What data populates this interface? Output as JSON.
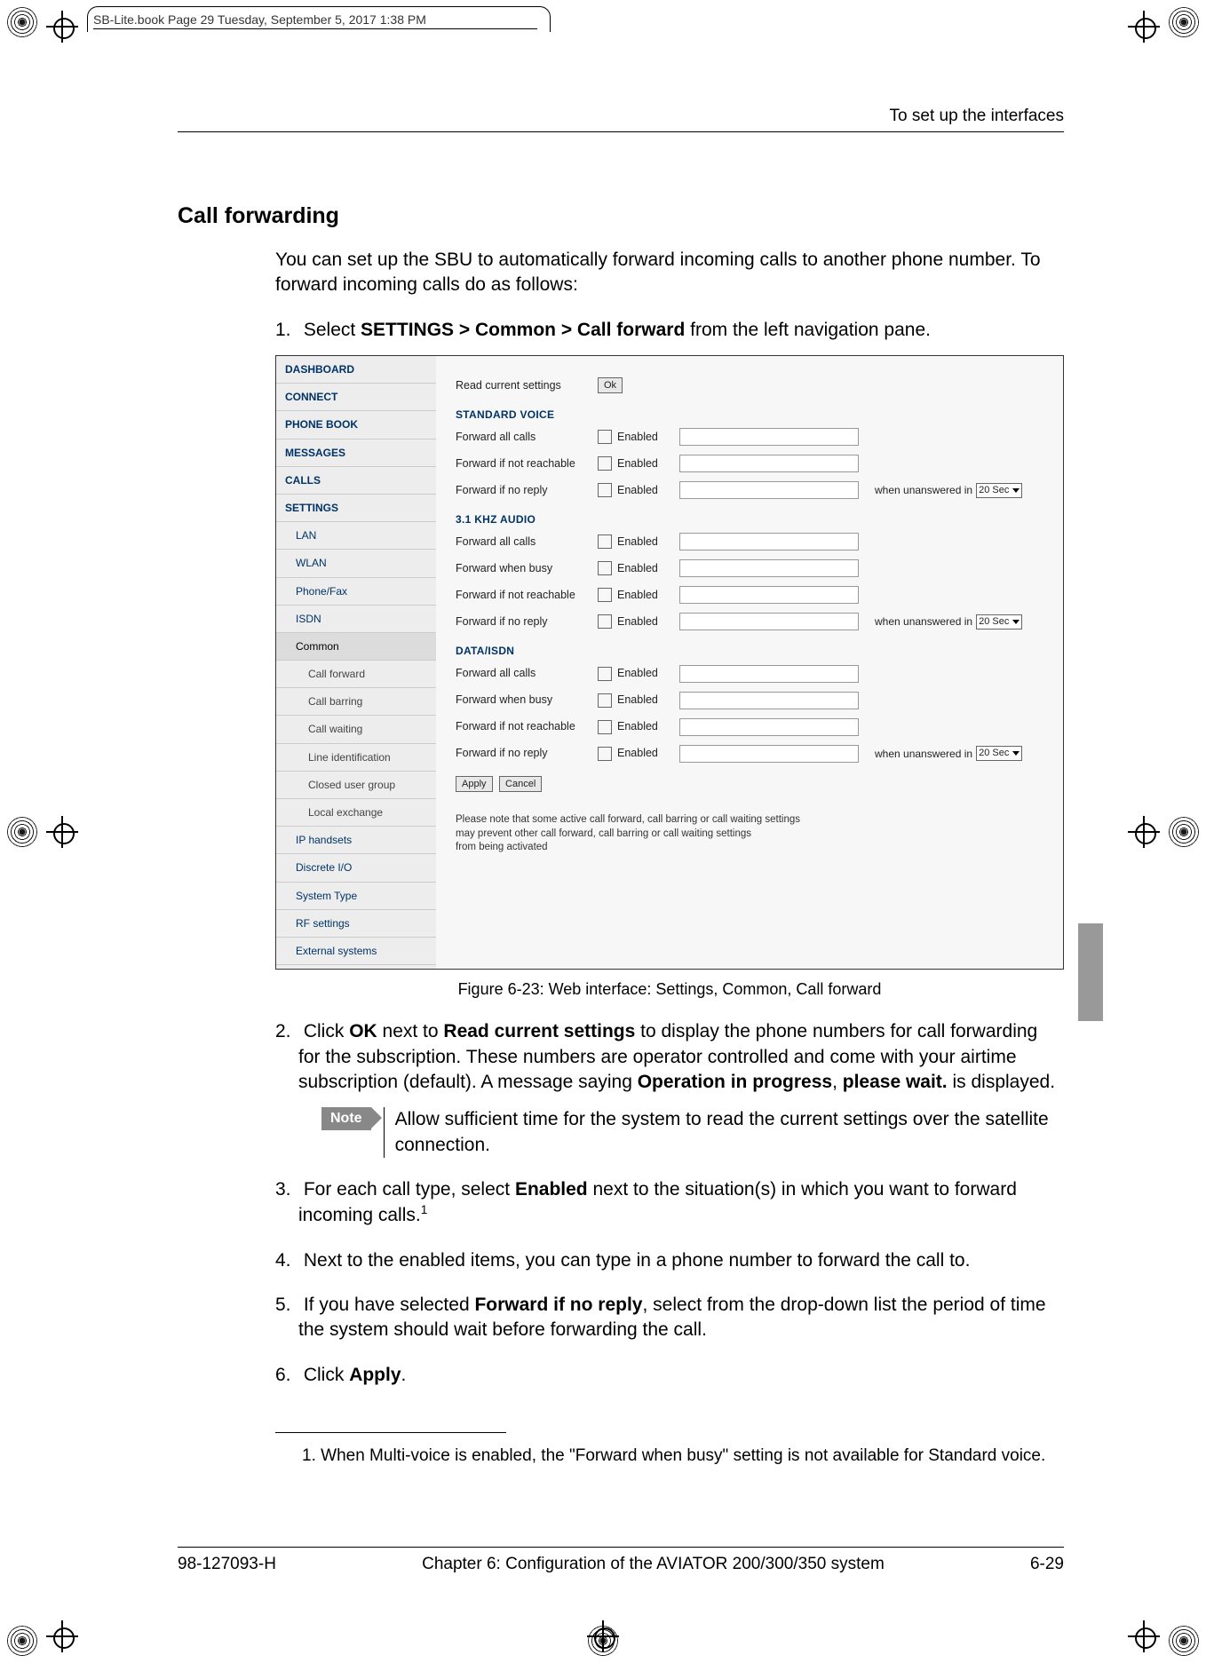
{
  "framemaker_header": "SB-Lite.book  Page 29  Tuesday, September 5, 2017  1:38 PM",
  "running_head": "To set up the interfaces",
  "section_title": "Call forwarding",
  "intro_p1": "You can set up the SBU to automatically forward incoming calls to another phone number. To forward incoming calls do as follows:",
  "step1_prefix": "1.",
  "step1_a": "Select ",
  "step1_bold": "SETTINGS > Common > Call forward",
  "step1_b": " from the left navigation pane.",
  "figure_caption": "Figure 6-23: Web interface: Settings, Common, Call forward",
  "step2_prefix": "2.",
  "step2_a": "Click ",
  "step2_b1": "OK",
  "step2_c": " next to ",
  "step2_b2": "Read current settings",
  "step2_d": " to display the phone numbers for call forwarding for the subscription. These numbers are operator controlled and come with your airtime subscription (default). A message saying ",
  "step2_b3": "Operation in progress",
  "step2_e": ", ",
  "step2_b4": "please wait.",
  "step2_f": " is displayed.",
  "note_label": "Note",
  "note_text": "Allow sufficient time for the system to read the current settings over the satellite connection.",
  "step3_prefix": "3.",
  "step3_a": "For each call type, select ",
  "step3_b": "Enabled",
  "step3_c": " next to the situation(s) in which you want to forward incoming calls.",
  "step3_sup": "1",
  "step4_prefix": "4.",
  "step4": "Next to the enabled items, you can type in a phone number to forward the call to.",
  "step5_prefix": "5.",
  "step5_a": "If you have selected ",
  "step5_b": "Forward if no reply",
  "step5_c": ", select from the drop-down list the period of time the system should wait before forwarding the call.",
  "step6_prefix": "6.",
  "step6_a": "Click ",
  "step6_b": "Apply",
  "step6_c": ".",
  "footnote_num": "1.",
  "footnote_text": "When Multi-voice is enabled, the \"Forward when busy\" setting is not available for Standard voice.",
  "footer_left": "98-127093-H",
  "footer_center": "Chapter 6:  Configuration of the AVIATOR 200/300/350 system",
  "footer_right": "6-29",
  "screenshot": {
    "read_label": "Read current settings",
    "ok_btn": "Ok",
    "enabled_label": "Enabled",
    "when_label": "when unanswered in",
    "timeout_value": "20 Sec",
    "apply_btn": "Apply",
    "cancel_btn": "Cancel",
    "footer_note_l1": "Please note that some active call forward, call barring or call waiting settings",
    "footer_note_l2": "may prevent other call forward, call barring or call waiting settings",
    "footer_note_l3": "from being activated",
    "nav": [
      {
        "label": "DASHBOARD",
        "level": 0
      },
      {
        "label": "CONNECT",
        "level": 0
      },
      {
        "label": "PHONE BOOK",
        "level": 0
      },
      {
        "label": "MESSAGES",
        "level": 0
      },
      {
        "label": "CALLS",
        "level": 0
      },
      {
        "label": "SETTINGS",
        "level": 0
      },
      {
        "label": "LAN",
        "level": 1
      },
      {
        "label": "WLAN",
        "level": 1
      },
      {
        "label": "Phone/Fax",
        "level": 1
      },
      {
        "label": "ISDN",
        "level": 1
      },
      {
        "label": "Common",
        "level": 1,
        "active": true
      },
      {
        "label": "Call forward",
        "level": 2
      },
      {
        "label": "Call barring",
        "level": 2
      },
      {
        "label": "Call waiting",
        "level": 2
      },
      {
        "label": "Line identification",
        "level": 2
      },
      {
        "label": "Closed user group",
        "level": 2
      },
      {
        "label": "Local exchange",
        "level": 2
      },
      {
        "label": "IP handsets",
        "level": 1
      },
      {
        "label": "Discrete I/O",
        "level": 1
      },
      {
        "label": "System Type",
        "level": 1
      },
      {
        "label": "RF settings",
        "level": 1
      },
      {
        "label": "External systems",
        "level": 1
      }
    ],
    "groups": [
      {
        "title": "STANDARD VOICE",
        "rows": [
          {
            "label": "Forward all calls",
            "timeout": false
          },
          {
            "label": "Forward if not reachable",
            "timeout": false
          },
          {
            "label": "Forward if no reply",
            "timeout": true
          }
        ]
      },
      {
        "title": "3.1 KHZ AUDIO",
        "rows": [
          {
            "label": "Forward all calls",
            "timeout": false
          },
          {
            "label": "Forward when busy",
            "timeout": false
          },
          {
            "label": "Forward if not reachable",
            "timeout": false
          },
          {
            "label": "Forward if no reply",
            "timeout": true
          }
        ]
      },
      {
        "title": "DATA/ISDN",
        "rows": [
          {
            "label": "Forward all calls",
            "timeout": false
          },
          {
            "label": "Forward when busy",
            "timeout": false
          },
          {
            "label": "Forward if not reachable",
            "timeout": false
          },
          {
            "label": "Forward if no reply",
            "timeout": true
          }
        ]
      }
    ]
  }
}
